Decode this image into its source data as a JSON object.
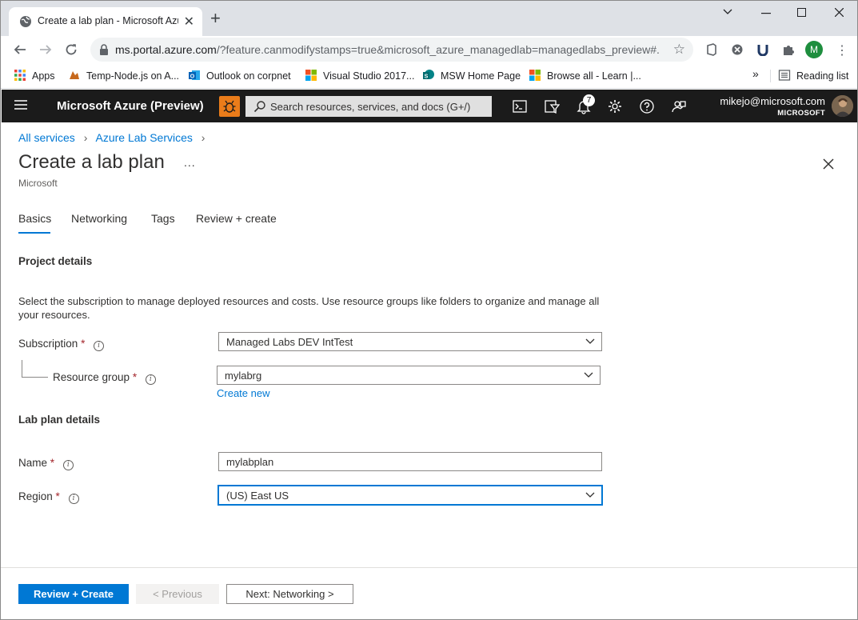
{
  "browser": {
    "tab_title": "Create a lab plan - Microsoft Azure",
    "new_tab_symbol": "+",
    "url_host": "ms.portal.azure.com",
    "url_rest": "/?feature.canmodifystamps=true&microsoft_azure_managedlab=managedlabs_preview#...",
    "profile_initial": "M"
  },
  "bookmarks": [
    {
      "label": "Apps",
      "icon": "apps-grid-icon"
    },
    {
      "label": "Temp-Node.js on A...",
      "icon": "folder-icon"
    },
    {
      "label": "Outlook on corpnet",
      "icon": "outlook-icon"
    },
    {
      "label": "Visual Studio 2017...",
      "icon": "microsoft-logo-icon"
    },
    {
      "label": "MSW Home Page",
      "icon": "sharepoint-icon"
    },
    {
      "label": "Browse all - Learn |...",
      "icon": "microsoft-logo-icon"
    }
  ],
  "bookmarks_overflow": "»",
  "reading_list": "Reading list",
  "azure": {
    "brand": "Microsoft Azure (Preview)",
    "search_placeholder": "Search resources, services, and docs (G+/)",
    "notification_count": "7",
    "user_email": "mikejo@microsoft.com",
    "user_tenant": "MICROSOFT"
  },
  "breadcrumb": [
    "All services",
    "Azure Lab Services"
  ],
  "page": {
    "title": "Create a lab plan",
    "more": "...",
    "subtitle": "Microsoft"
  },
  "tabs": [
    "Basics",
    "Networking",
    "Tags",
    "Review + create"
  ],
  "project_details": {
    "heading": "Project details",
    "description": "Select the subscription to manage deployed resources and costs. Use resource groups like folders to organize and manage all your resources."
  },
  "fields": {
    "subscription": {
      "label": "Subscription",
      "required": "*",
      "value": "Managed Labs DEV IntTest"
    },
    "resource_group": {
      "label": "Resource group",
      "required": "*",
      "value": "mylabrg",
      "create_new": "Create new"
    },
    "name": {
      "label": "Name",
      "required": "*",
      "value": "mylabplan"
    },
    "region": {
      "label": "Region",
      "required": "*",
      "value": "(US) East US"
    }
  },
  "lab_plan_details": {
    "heading": "Lab plan details"
  },
  "footer": {
    "review_create": "Review + Create",
    "previous": "< Previous",
    "next": "Next: Networking >"
  },
  "colors": {
    "azure_header": "#1b1b1b",
    "accent": "#0078d4",
    "bug_orange": "#ea7c1a",
    "required": "#a4262c"
  }
}
